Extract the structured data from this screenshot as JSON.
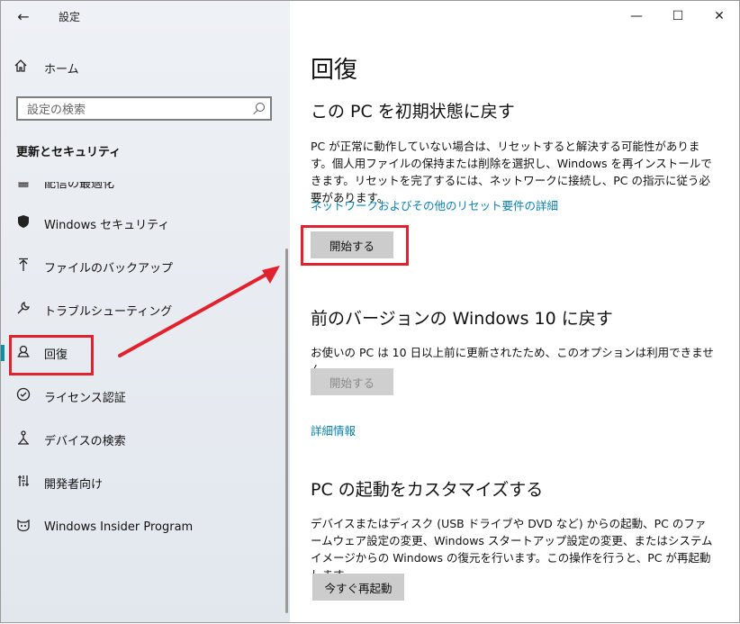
{
  "window": {
    "back_icon": "back-arrow-icon",
    "title": "設定",
    "minimize": "—",
    "maximize": "☐",
    "close": "✕"
  },
  "sidebar": {
    "home_label": "ホーム",
    "search_placeholder": "設定の検索",
    "section_title": "更新とセキュリティ",
    "items": [
      {
        "label": "配信の最適化",
        "icon": "delivery-optimization-icon"
      },
      {
        "label": "Windows セキュリティ",
        "icon": "shield-icon"
      },
      {
        "label": "ファイルのバックアップ",
        "icon": "backup-arrow-icon"
      },
      {
        "label": "トラブルシューティング",
        "icon": "wrench-icon"
      },
      {
        "label": "回復",
        "icon": "recovery-icon",
        "active": true
      },
      {
        "label": "ライセンス認証",
        "icon": "checkmark-circle-icon"
      },
      {
        "label": "デバイスの検索",
        "icon": "find-device-icon"
      },
      {
        "label": "開発者向け",
        "icon": "developer-icon"
      },
      {
        "label": "Windows Insider Program",
        "icon": "insider-cat-icon"
      }
    ]
  },
  "main": {
    "title": "回復",
    "reset": {
      "heading": "この PC を初期状態に戻す",
      "description": "PC が正常に動作していない場合は、リセットすると解決する可能性があります。個人用ファイルの保持または削除を選択し、Windows を再インストールできます。リセットを完了するには、ネットワークに接続し、PC の指示に従う必要があります。",
      "link": "ネットワークおよびその他のリセット要件の詳細",
      "button": "開始する"
    },
    "previous": {
      "heading": "前のバージョンの Windows 10 に戻す",
      "description": "お使いの PC は 10 日以上前に更新されたため、このオプションは利用できません。",
      "button": "開始する",
      "link": "詳細情報"
    },
    "startup": {
      "heading": "PC の起動をカスタマイズする",
      "description": "デバイスまたはディスク (USB ドライブや DVD など) からの起動、PC のファームウェア設定の変更、Windows スタートアップ設定の変更、またはシステム イメージからの Windows の復元を行います。この操作を行うと、PC が再起動します。",
      "button": "今すぐ再起動"
    }
  },
  "colors": {
    "accent": "#0a91a8",
    "link": "#0a7fa8",
    "annotation": "#e0222f"
  }
}
